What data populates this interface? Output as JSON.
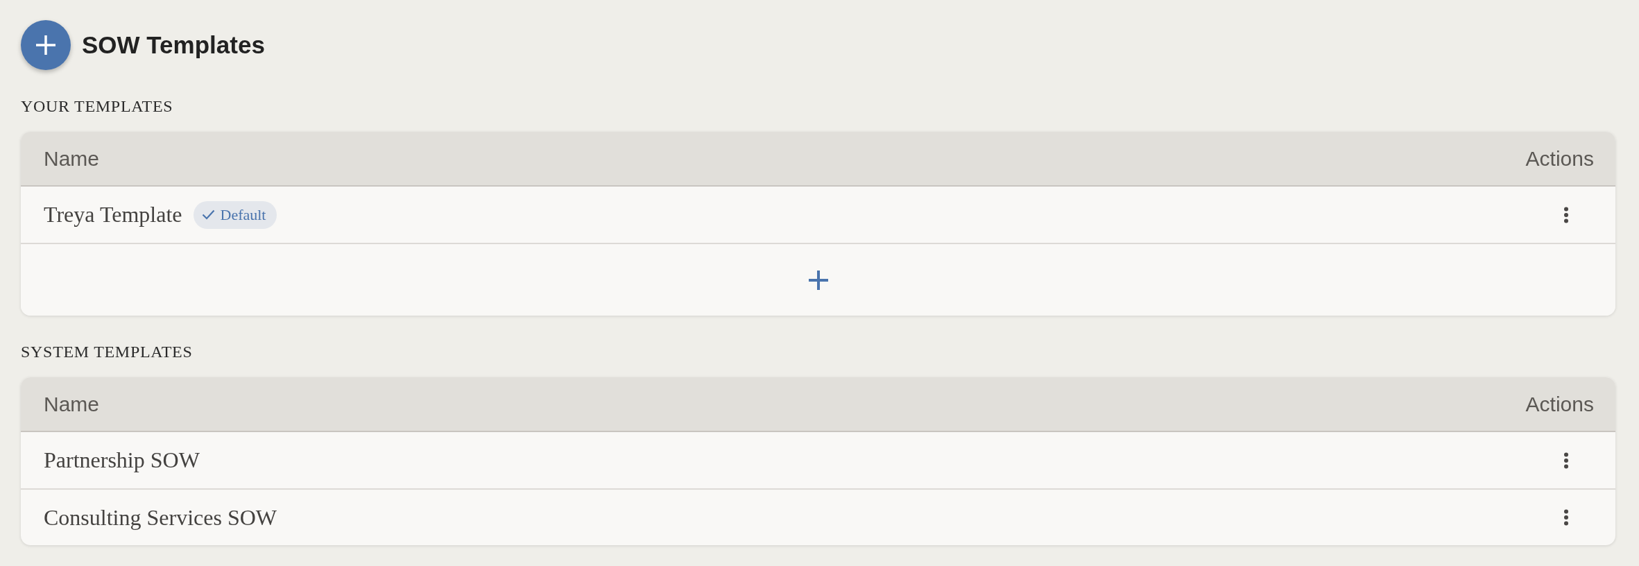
{
  "header": {
    "title": "SOW Templates"
  },
  "sections": [
    {
      "label": "YOUR TEMPLATES",
      "columns": [
        "Name",
        "Actions"
      ],
      "rows": [
        {
          "name": "Treya Template",
          "badge": "Default"
        }
      ],
      "add_row": true
    },
    {
      "label": "SYSTEM TEMPLATES",
      "columns": [
        "Name",
        "Actions"
      ],
      "rows": [
        {
          "name": "Partnership SOW"
        },
        {
          "name": "Consulting Services SOW"
        }
      ],
      "add_row": false
    }
  ]
}
